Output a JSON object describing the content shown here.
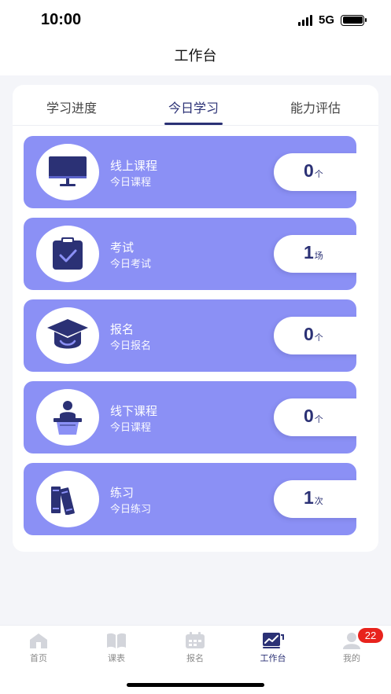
{
  "status_bar": {
    "time": "10:00",
    "network": "5G"
  },
  "header": {
    "title": "工作台"
  },
  "tabs": [
    {
      "label": "学习进度",
      "active": false
    },
    {
      "label": "今日学习",
      "active": true
    },
    {
      "label": "能力评估",
      "active": false
    }
  ],
  "items": [
    {
      "title": "线上课程",
      "subtitle": "今日课程",
      "count": "0",
      "unit": "个",
      "icon": "monitor-icon"
    },
    {
      "title": "考试",
      "subtitle": "今日考试",
      "count": "1",
      "unit": "场",
      "icon": "clipboard-check-icon"
    },
    {
      "title": "报名",
      "subtitle": "今日报名",
      "count": "0",
      "unit": "个",
      "icon": "graduation-cap-icon"
    },
    {
      "title": "线下课程",
      "subtitle": "今日课程",
      "count": "0",
      "unit": "个",
      "icon": "lecturer-podium-icon"
    },
    {
      "title": "练习",
      "subtitle": "今日练习",
      "count": "1",
      "unit": "次",
      "icon": "books-icon"
    }
  ],
  "tabbar": [
    {
      "label": "首页",
      "icon": "home-icon",
      "active": false
    },
    {
      "label": "课表",
      "icon": "book-open-icon",
      "active": false
    },
    {
      "label": "报名",
      "icon": "calendar-icon",
      "active": false
    },
    {
      "label": "工作台",
      "icon": "chart-icon",
      "active": true
    },
    {
      "label": "我的",
      "icon": "user-icon",
      "active": false,
      "badge": "22"
    }
  ],
  "colors": {
    "accent": "#2b3175",
    "item_bg": "#8b90f5",
    "badge": "#e8231d"
  }
}
